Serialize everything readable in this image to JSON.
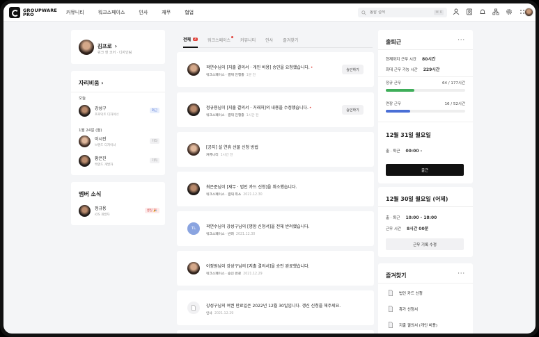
{
  "logo": {
    "line1": "GROUPWARE",
    "line2": "PRO"
  },
  "nav": [
    "커뮤니티",
    "워크스페이스",
    "인사",
    "재무",
    "협업"
  ],
  "search": {
    "placeholder": "통합 검색",
    "shortcut": "⌘ K"
  },
  "topbar_icons": [
    "org-chart-icon",
    "contact-icon",
    "bell-icon",
    "sitemap-icon",
    "settings-icon",
    "apps-grid-icon"
  ],
  "profile": {
    "name": "김프로",
    "role": "워크 앤 코어 · 디자인팀"
  },
  "seats": {
    "title": "자리비움",
    "today_label": "오늘",
    "today": [
      {
        "name": "강성구",
        "role": "프로덕트 디자이너",
        "badge": "외근"
      }
    ],
    "date_label": "1월 24일 (월)",
    "upcoming": [
      {
        "name": "이시진",
        "role": "브랜드 디자이너",
        "badge": "기타"
      },
      {
        "name": "황은진",
        "role": "백엔드 개발자",
        "badge": "기타"
      }
    ]
  },
  "member_news": {
    "title": "멤버 소식",
    "items": [
      {
        "name": "정규용",
        "role": "iOS 개발자",
        "badge": "생일 🎉"
      }
    ]
  },
  "tabs": [
    {
      "label": "전체",
      "count": "2"
    },
    {
      "label": "워크스페이스"
    },
    {
      "label": "커뮤니티"
    },
    {
      "label": "인사"
    },
    {
      "label": "즐겨찾기"
    }
  ],
  "feed": [
    {
      "title": "곽연수님이 [지출 결의서 · 개인 비용] 승인을 요청했습니다.",
      "unread": true,
      "source": "워크스페이스 · 결재 진행중",
      "time": "1분 전",
      "action": "승인하기",
      "avatar": "f"
    },
    {
      "title": "정규용님이 [지출 결의서 · 거래처]의 내용을 수정했습니다.",
      "unread": true,
      "source": "워크스페이스 · 결재 진행중",
      "time": "1시간 전",
      "action": "승인하기",
      "avatar": "m"
    },
    {
      "title": "[공지] 설 연휴 선물 신청 방법",
      "source": "커뮤니티",
      "time": "1시간 전",
      "avatar": "f2"
    },
    {
      "title": "최은준님이 [재무 · 법인 카드 신청]을 취소했습니다.",
      "source": "워크스페이스 · 결재 취소",
      "time": "2021.12.30",
      "avatar": "m"
    },
    {
      "title": "곽연수님이 강성구님의 [명함 신청서]을 전체 반려했습니다.",
      "source": "워크스페이스 · 반려",
      "time": "2021.12.30",
      "initials": "TL"
    },
    {
      "title": "이정원님이 강성구님의 [지출 결의서]을 승인 완료했습니다.",
      "source": "워크스페이스 · 승인 완료",
      "time": "2021.12.29",
      "avatar": "f"
    },
    {
      "title": "강성구님의 여권 만료일은 2022년 12월 30일입니다. 갱신 신청을 해주세요.",
      "source": "인사",
      "time": "2021.12.29",
      "doc": true
    }
  ],
  "attendance": {
    "title": "출퇴근",
    "current_label": "현재까지 근무 시간",
    "current_value": "80시간",
    "max_label": "최대 근무 가능 시간",
    "max_value": "229시간",
    "regular_label": "정규 근무",
    "regular_value": "64 / 177시간",
    "regular_fraction": 0.36,
    "regular_color": "#3fae5a",
    "extended_label": "연장 근무",
    "extended_value": "16 / 52시간",
    "extended_fraction": 0.31,
    "extended_color": "#4a6fd6",
    "today_date": "12월 31일 월요일",
    "checkin_label": "출 · 퇴근",
    "checkin_value": "00:00 -",
    "button": "출근"
  },
  "yesterday": {
    "date": "12월 30일 월요일 (어제)",
    "checkin_label": "출 · 퇴근",
    "checkin_value": "10:00 - 18:00",
    "worktime_label": "근무 시간",
    "worktime_value": "8시간 00분",
    "button": "근무 기록 수정"
  },
  "favorites": {
    "title": "즐겨찾기",
    "items": [
      "법인 카드 신청",
      "휴가 신청서",
      "지출 결의서 (개인 비용)"
    ]
  }
}
